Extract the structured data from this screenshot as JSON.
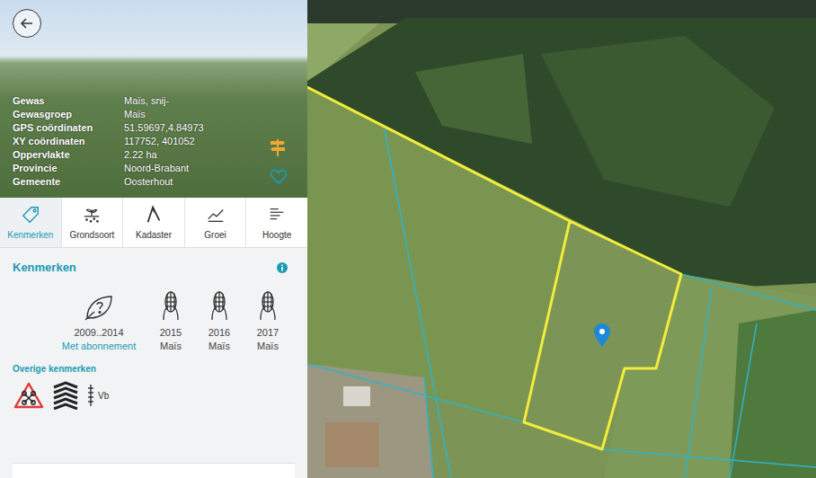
{
  "crop_info": [
    {
      "label": "Gewas",
      "value": "Maïs, snij-"
    },
    {
      "label": "Gewasgroep",
      "value": "Maïs"
    },
    {
      "label": "GPS coördinaten",
      "value": "51.59697,4.84973"
    },
    {
      "label": "XY coördinaten",
      "value": "117752, 401052"
    },
    {
      "label": "Oppervlakte",
      "value": "2.22 ha"
    },
    {
      "label": "Provincie",
      "value": "Noord-Brabant"
    },
    {
      "label": "Gemeente",
      "value": "Oosterhout"
    }
  ],
  "tabs": [
    {
      "label": "Kenmerken",
      "selected": true
    },
    {
      "label": "Grondsoort",
      "selected": false
    },
    {
      "label": "Kadaster",
      "selected": false
    },
    {
      "label": "Groei",
      "selected": false
    },
    {
      "label": "Hoogte",
      "selected": false
    }
  ],
  "section": {
    "title": "Kenmerken"
  },
  "history": [
    {
      "kind": "locked",
      "years": "2009..2014",
      "crop": "Met abonnement"
    },
    {
      "kind": "corn",
      "years": "2015",
      "crop": "Maïs"
    },
    {
      "kind": "corn",
      "years": "2016",
      "crop": "Maïs"
    },
    {
      "kind": "corn",
      "years": "2017",
      "crop": "Maïs"
    }
  ],
  "other": {
    "title": "Overige kenmerken",
    "items": [
      {
        "kind": "drone-warning",
        "label": ""
      },
      {
        "kind": "layers",
        "label": ""
      },
      {
        "kind": "water-level",
        "label": "Vb"
      }
    ]
  }
}
